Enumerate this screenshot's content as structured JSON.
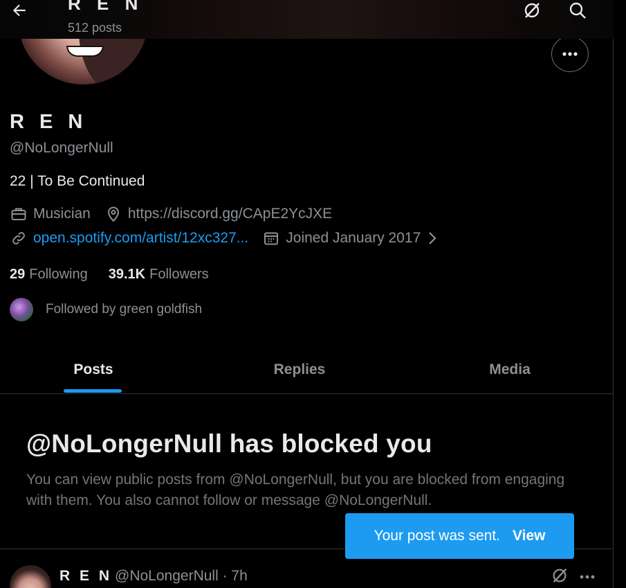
{
  "header": {
    "name": "R E N",
    "post_count": "512 posts"
  },
  "profile": {
    "name": "R E N",
    "handle": "@NoLongerNull",
    "bio": "22 | To Be Continued",
    "category": "Musician",
    "location": "https://discord.gg/CApE2YcJXE",
    "website": "open.spotify.com/artist/12xc327...",
    "joined": "Joined January 2017",
    "following_count": "29",
    "following_label": "Following",
    "followers_count": "39.1K",
    "followers_label": "Followers",
    "followed_by": "Followed by green goldfish"
  },
  "tabs": [
    {
      "label": "Posts",
      "active": true
    },
    {
      "label": "Replies",
      "active": false
    },
    {
      "label": "Media",
      "active": false
    }
  ],
  "blocked": {
    "title": "@NoLongerNull has blocked you",
    "message": "You can view public posts from @NoLongerNull, but you are blocked from engaging with them. You also cannot follow or message @NoLongerNull."
  },
  "post": {
    "name": "R E N",
    "handle_time": "@NoLongerNull · 7h"
  },
  "toast": {
    "message": "Your post was sent.",
    "action": "View"
  },
  "colors": {
    "accent": "#1d9bf0",
    "background": "#000000",
    "muted_text": "#8b9196"
  },
  "icons": [
    "back-arrow-icon",
    "grok-icon",
    "search-icon",
    "more-icon",
    "briefcase-icon",
    "location-pin-icon",
    "link-icon",
    "calendar-icon",
    "chevron-right-icon"
  ]
}
